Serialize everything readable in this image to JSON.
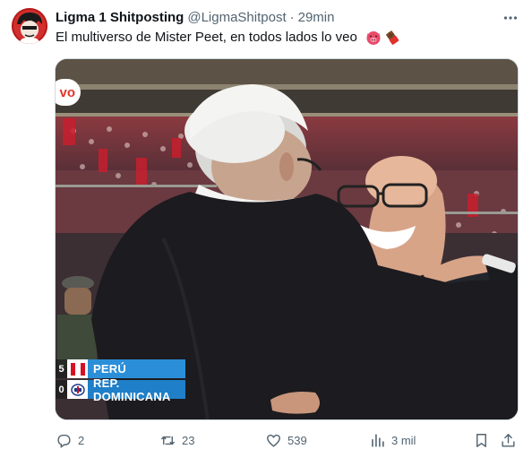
{
  "author": {
    "display_name": "Ligma 1 Shitposting",
    "handle": "@LigmaShitpost",
    "separator": "·",
    "time": "29min"
  },
  "tweet": {
    "text": "El multiverso de Mister Peet, en todos lados lo veo",
    "emojis": [
      "pig-face-emoji",
      "chocolate-emoji"
    ]
  },
  "media": {
    "watermark": "vo",
    "scoreboard": {
      "team1": {
        "name": "PERÚ",
        "score": "5"
      },
      "team2": {
        "name": "REP. DOMINICANA",
        "score": "0"
      }
    }
  },
  "actions": {
    "replies": "2",
    "retweets": "23",
    "likes": "539",
    "views": "3 mil"
  },
  "colors": {
    "text_primary": "#0f1419",
    "text_secondary": "#536471",
    "scoreboard_blue": "#2a8fd8",
    "brand_red": "#d7263d"
  }
}
